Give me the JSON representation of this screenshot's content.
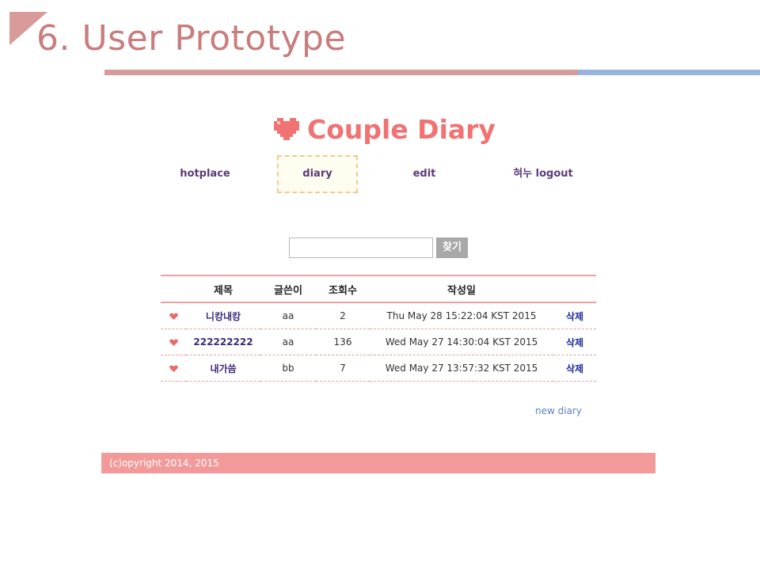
{
  "slide": {
    "title": "6. User Prototype",
    "accent_color": "#d99a9a",
    "secondary_accent_color": "#96b4dc"
  },
  "app": {
    "title": "Couple Diary",
    "title_color": "#f07272",
    "logo_icon": "pixel-heart-icon"
  },
  "nav": {
    "items": [
      {
        "label": "hotplace",
        "active": false
      },
      {
        "label": "diary",
        "active": true
      },
      {
        "label": "edit",
        "active": false
      },
      {
        "label": "혀누 logout",
        "active": false
      }
    ]
  },
  "search": {
    "value": "",
    "button_label": "찾기"
  },
  "table": {
    "headers": [
      "",
      "제목",
      "글쓴이",
      "조회수",
      "작성일",
      ""
    ],
    "rows": [
      {
        "icon": "heart-icon",
        "title": "니캉내캉",
        "writer": "aa",
        "views": "2",
        "date": "Thu May 28 15:22:04 KST 2015",
        "action": "삭제"
      },
      {
        "icon": "heart-icon",
        "title": "222222222",
        "writer": "aa",
        "views": "136",
        "date": "Wed May 27 14:30:04 KST 2015",
        "action": "삭제"
      },
      {
        "icon": "heart-icon",
        "title": "내가씀",
        "writer": "bb",
        "views": "7",
        "date": "Wed May 27 13:57:32 KST 2015",
        "action": "삭제"
      }
    ]
  },
  "new_diary_link": "new diary",
  "footer": {
    "text": "(c)opyright 2014, 2015",
    "color": "#f29a9a"
  }
}
